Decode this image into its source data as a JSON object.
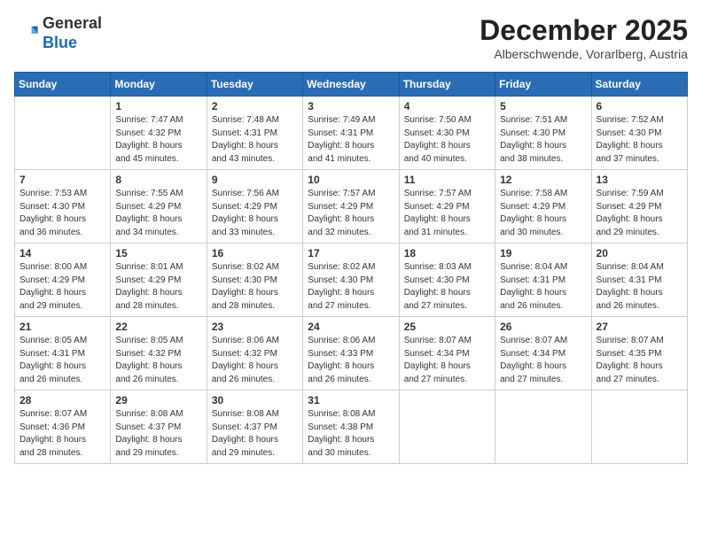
{
  "header": {
    "logo": {
      "general": "General",
      "blue": "Blue"
    },
    "title": "December 2025",
    "subtitle": "Alberschwende, Vorarlberg, Austria"
  },
  "weekdays": [
    "Sunday",
    "Monday",
    "Tuesday",
    "Wednesday",
    "Thursday",
    "Friday",
    "Saturday"
  ],
  "weeks": [
    [
      {
        "day": "",
        "info": ""
      },
      {
        "day": "1",
        "info": "Sunrise: 7:47 AM\nSunset: 4:32 PM\nDaylight: 8 hours\nand 45 minutes."
      },
      {
        "day": "2",
        "info": "Sunrise: 7:48 AM\nSunset: 4:31 PM\nDaylight: 8 hours\nand 43 minutes."
      },
      {
        "day": "3",
        "info": "Sunrise: 7:49 AM\nSunset: 4:31 PM\nDaylight: 8 hours\nand 41 minutes."
      },
      {
        "day": "4",
        "info": "Sunrise: 7:50 AM\nSunset: 4:30 PM\nDaylight: 8 hours\nand 40 minutes."
      },
      {
        "day": "5",
        "info": "Sunrise: 7:51 AM\nSunset: 4:30 PM\nDaylight: 8 hours\nand 38 minutes."
      },
      {
        "day": "6",
        "info": "Sunrise: 7:52 AM\nSunset: 4:30 PM\nDaylight: 8 hours\nand 37 minutes."
      }
    ],
    [
      {
        "day": "7",
        "info": "Sunrise: 7:53 AM\nSunset: 4:30 PM\nDaylight: 8 hours\nand 36 minutes."
      },
      {
        "day": "8",
        "info": "Sunrise: 7:55 AM\nSunset: 4:29 PM\nDaylight: 8 hours\nand 34 minutes."
      },
      {
        "day": "9",
        "info": "Sunrise: 7:56 AM\nSunset: 4:29 PM\nDaylight: 8 hours\nand 33 minutes."
      },
      {
        "day": "10",
        "info": "Sunrise: 7:57 AM\nSunset: 4:29 PM\nDaylight: 8 hours\nand 32 minutes."
      },
      {
        "day": "11",
        "info": "Sunrise: 7:57 AM\nSunset: 4:29 PM\nDaylight: 8 hours\nand 31 minutes."
      },
      {
        "day": "12",
        "info": "Sunrise: 7:58 AM\nSunset: 4:29 PM\nDaylight: 8 hours\nand 30 minutes."
      },
      {
        "day": "13",
        "info": "Sunrise: 7:59 AM\nSunset: 4:29 PM\nDaylight: 8 hours\nand 29 minutes."
      }
    ],
    [
      {
        "day": "14",
        "info": "Sunrise: 8:00 AM\nSunset: 4:29 PM\nDaylight: 8 hours\nand 29 minutes."
      },
      {
        "day": "15",
        "info": "Sunrise: 8:01 AM\nSunset: 4:29 PM\nDaylight: 8 hours\nand 28 minutes."
      },
      {
        "day": "16",
        "info": "Sunrise: 8:02 AM\nSunset: 4:30 PM\nDaylight: 8 hours\nand 28 minutes."
      },
      {
        "day": "17",
        "info": "Sunrise: 8:02 AM\nSunset: 4:30 PM\nDaylight: 8 hours\nand 27 minutes."
      },
      {
        "day": "18",
        "info": "Sunrise: 8:03 AM\nSunset: 4:30 PM\nDaylight: 8 hours\nand 27 minutes."
      },
      {
        "day": "19",
        "info": "Sunrise: 8:04 AM\nSunset: 4:31 PM\nDaylight: 8 hours\nand 26 minutes."
      },
      {
        "day": "20",
        "info": "Sunrise: 8:04 AM\nSunset: 4:31 PM\nDaylight: 8 hours\nand 26 minutes."
      }
    ],
    [
      {
        "day": "21",
        "info": "Sunrise: 8:05 AM\nSunset: 4:31 PM\nDaylight: 8 hours\nand 26 minutes."
      },
      {
        "day": "22",
        "info": "Sunrise: 8:05 AM\nSunset: 4:32 PM\nDaylight: 8 hours\nand 26 minutes."
      },
      {
        "day": "23",
        "info": "Sunrise: 8:06 AM\nSunset: 4:32 PM\nDaylight: 8 hours\nand 26 minutes."
      },
      {
        "day": "24",
        "info": "Sunrise: 8:06 AM\nSunset: 4:33 PM\nDaylight: 8 hours\nand 26 minutes."
      },
      {
        "day": "25",
        "info": "Sunrise: 8:07 AM\nSunset: 4:34 PM\nDaylight: 8 hours\nand 27 minutes."
      },
      {
        "day": "26",
        "info": "Sunrise: 8:07 AM\nSunset: 4:34 PM\nDaylight: 8 hours\nand 27 minutes."
      },
      {
        "day": "27",
        "info": "Sunrise: 8:07 AM\nSunset: 4:35 PM\nDaylight: 8 hours\nand 27 minutes."
      }
    ],
    [
      {
        "day": "28",
        "info": "Sunrise: 8:07 AM\nSunset: 4:36 PM\nDaylight: 8 hours\nand 28 minutes."
      },
      {
        "day": "29",
        "info": "Sunrise: 8:08 AM\nSunset: 4:37 PM\nDaylight: 8 hours\nand 29 minutes."
      },
      {
        "day": "30",
        "info": "Sunrise: 8:08 AM\nSunset: 4:37 PM\nDaylight: 8 hours\nand 29 minutes."
      },
      {
        "day": "31",
        "info": "Sunrise: 8:08 AM\nSunset: 4:38 PM\nDaylight: 8 hours\nand 30 minutes."
      },
      {
        "day": "",
        "info": ""
      },
      {
        "day": "",
        "info": ""
      },
      {
        "day": "",
        "info": ""
      }
    ]
  ]
}
